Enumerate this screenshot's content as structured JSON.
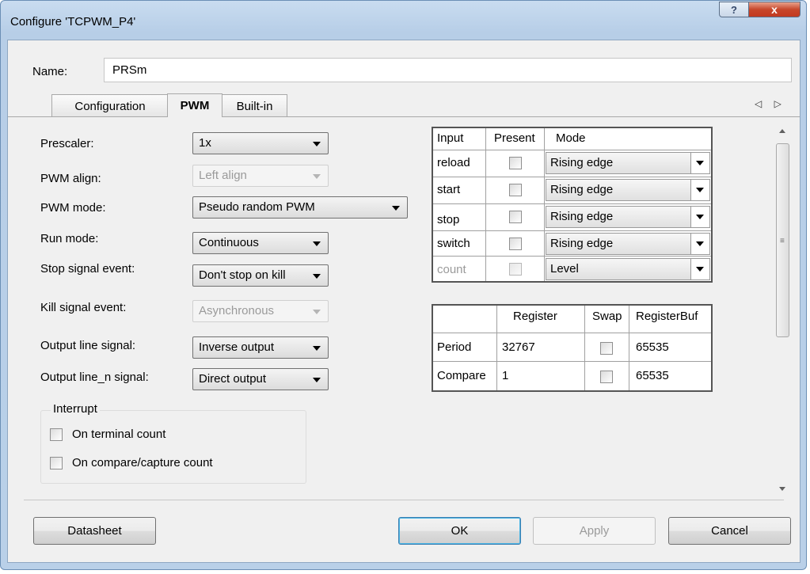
{
  "window": {
    "title": "Configure 'TCPWM_P4'",
    "help_glyph": "?",
    "close_glyph": "x"
  },
  "name_field": {
    "label": "Name:",
    "value": "PRSm"
  },
  "tabs": [
    "Configuration",
    "PWM",
    "Built-in"
  ],
  "active_tab": "PWM",
  "tab_scroll_arrows": "◁ ▷",
  "settings": [
    {
      "label": "Prescaler:",
      "value": "1x",
      "enabled": true
    },
    {
      "label": "PWM align:",
      "value": "Left align",
      "enabled": false
    },
    {
      "label": "PWM mode:",
      "value": "Pseudo random PWM",
      "enabled": true
    },
    {
      "label": "Run mode:",
      "value": "Continuous",
      "enabled": true
    },
    {
      "label": "Stop signal event:",
      "value": "Don't stop on kill",
      "enabled": true
    },
    {
      "label": "Kill signal event:",
      "value": "Asynchronous",
      "enabled": false
    },
    {
      "label": "Output line signal:",
      "value": "Inverse output",
      "enabled": true
    },
    {
      "label": "Output line_n signal:",
      "value": "Direct output",
      "enabled": true
    }
  ],
  "interrupt": {
    "title": "Interrupt",
    "options": [
      {
        "label": "On terminal count",
        "checked": false
      },
      {
        "label": "On compare/capture count",
        "checked": false
      }
    ]
  },
  "input_table": {
    "headers": [
      "Input",
      "Present",
      "Mode"
    ],
    "rows": [
      {
        "input": "reload",
        "present": false,
        "mode": "Rising edge",
        "enabled": true
      },
      {
        "input": "start",
        "present": false,
        "mode": "Rising edge",
        "enabled": true
      },
      {
        "input": "stop",
        "present": false,
        "mode": "Rising edge",
        "enabled": true
      },
      {
        "input": "switch",
        "present": false,
        "mode": "Rising edge",
        "enabled": true
      },
      {
        "input": "count",
        "present": false,
        "mode": "Level",
        "enabled": false
      }
    ]
  },
  "register_table": {
    "headers": [
      "",
      "Register",
      "Swap",
      "RegisterBuf"
    ],
    "rows": [
      {
        "name": "Period",
        "register": "32767",
        "swap": false,
        "registerbuf": "65535"
      },
      {
        "name": "Compare",
        "register": "1",
        "swap": false,
        "registerbuf": "65535"
      }
    ]
  },
  "scrollbar": {
    "grip": "≡"
  },
  "buttons": {
    "datasheet": "Datasheet",
    "ok": "OK",
    "apply": "Apply",
    "cancel": "Cancel"
  },
  "colors": {
    "title_bar": "#b9d0e8",
    "close_button": "#c7472b",
    "dialog_bg": "#f0f0f0",
    "disabled_text": "#9a9a9a"
  }
}
